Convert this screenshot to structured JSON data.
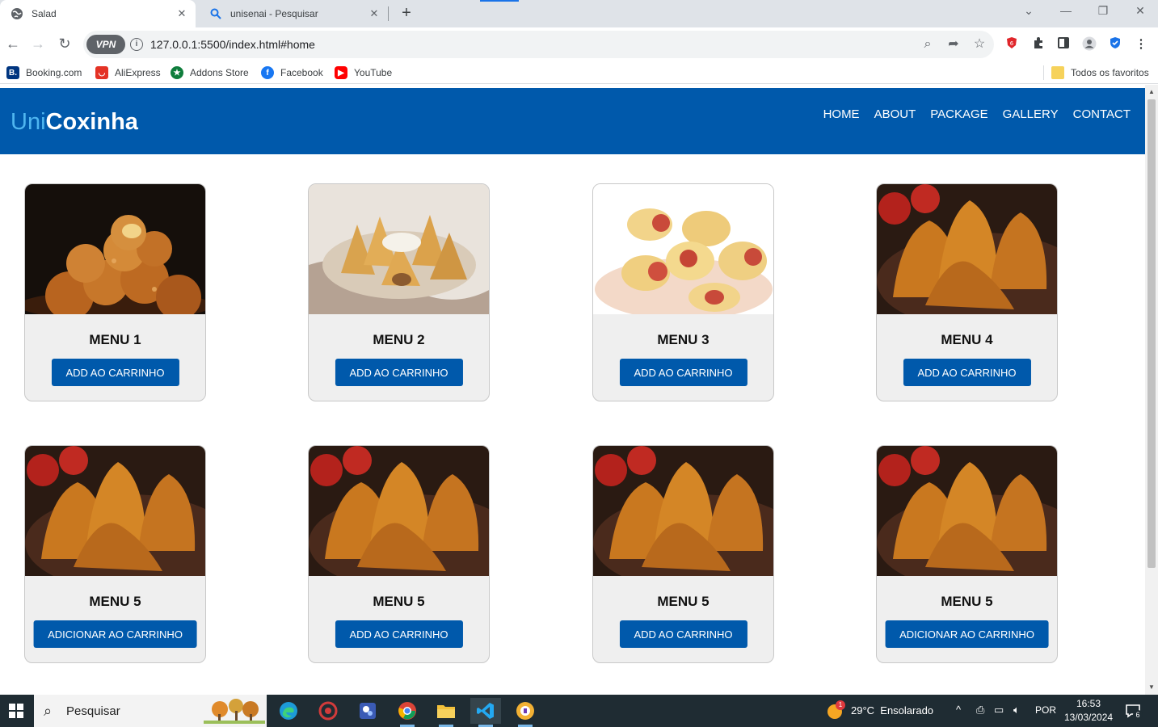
{
  "browser": {
    "tabs": [
      {
        "title": "Salad",
        "active": true
      },
      {
        "title": "unisenai - Pesquisar",
        "active": false
      }
    ],
    "url": "127.0.0.1:5500/index.html#home",
    "vpn_label": "VPN",
    "bookmarks": [
      {
        "label": "Booking.com",
        "icon": "booking-icon",
        "color": "#003580"
      },
      {
        "label": "AliExpress",
        "icon": "aliexpress-icon",
        "color": "#e43225"
      },
      {
        "label": "Addons Store",
        "icon": "addons-store-icon",
        "color": "#0f7d3c"
      },
      {
        "label": "Facebook",
        "icon": "facebook-icon",
        "color": "#1877f2"
      },
      {
        "label": "YouTube",
        "icon": "youtube-icon",
        "color": "#ff0000"
      }
    ],
    "all_bookmarks_label": "Todos os favoritos"
  },
  "site": {
    "logo_part1": "Uni",
    "logo_part2": "Coxinha",
    "nav": [
      "HOME",
      "ABOUT",
      "PACKAGE",
      "GALLERY",
      "CONTACT"
    ],
    "colors": {
      "primary": "#0059ab",
      "logo_accent": "#4fb6f0",
      "card_bg": "#efefef"
    }
  },
  "cards": [
    {
      "title": "MENU 1",
      "button": "ADD AO CARRINHO",
      "image": "coxinha-balls-photo"
    },
    {
      "title": "MENU 2",
      "button": "ADD AO CARRINHO",
      "image": "coxinha-plate-photo"
    },
    {
      "title": "MENU 3",
      "button": "ADD AO CARRINHO",
      "image": "sausage-rolls-photo"
    },
    {
      "title": "MENU 4",
      "button": "ADD AO CARRINHO",
      "image": "fried-coxinha-photo"
    },
    {
      "title": "MENU 5",
      "button": "ADICIONAR AO CARRINHO",
      "image": "fried-coxinha-photo"
    },
    {
      "title": "MENU 5",
      "button": "ADD AO CARRINHO",
      "image": "fried-coxinha-photo"
    },
    {
      "title": "MENU 5",
      "button": "ADD AO CARRINHO",
      "image": "fried-coxinha-photo"
    },
    {
      "title": "MENU 5",
      "button": "ADICIONAR AO CARRINHO",
      "image": "fried-coxinha-photo"
    }
  ],
  "taskbar": {
    "search_placeholder": "Pesquisar",
    "weather": "29°C  Ensolarado",
    "weather_badge": "1",
    "language": "POR",
    "time": "16:53",
    "date": "13/03/2024",
    "notifications": "6"
  }
}
